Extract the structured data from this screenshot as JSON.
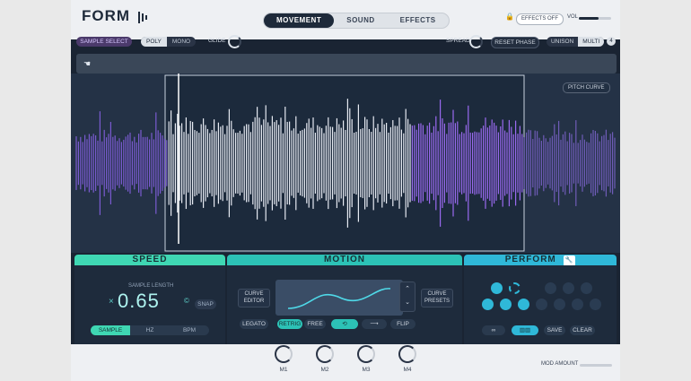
{
  "header": {
    "logo": "FORM",
    "tabs": [
      {
        "label": "MOVEMENT",
        "active": true
      },
      {
        "label": "SOUND",
        "active": false
      },
      {
        "label": "EFFECTS",
        "active": false
      }
    ],
    "effects_off": "EFFECTS OFF",
    "vol_label": "VOL",
    "vol_level": 0.6
  },
  "controls": {
    "sample_select": "SAMPLE SELECT",
    "poly": "POLY",
    "mono": "MONO",
    "glide": "GLIDE",
    "spread": "SPREAD",
    "reset_phase": "RESET PHASE",
    "unison": "UNISON",
    "multi": "MULTI",
    "unison_count": "4"
  },
  "waveform": {
    "pitch_curve": "PITCH CURVE"
  },
  "speed": {
    "title": "SPEED",
    "sample_length_label": "SAMPLE LENGTH",
    "value": "0.65",
    "x_mark": "×",
    "c_mark": "©",
    "snap": "SNAP",
    "modes": [
      {
        "label": "SAMPLE",
        "active": true
      },
      {
        "label": "HZ",
        "active": false
      },
      {
        "label": "BPM",
        "active": false
      }
    ]
  },
  "motion": {
    "title": "MOTION",
    "curve_editor_1": "CURVE",
    "curve_editor_2": "EDITOR",
    "curve_presets_1": "CURVE",
    "curve_presets_2": "PRESETS",
    "legato": "LEGATO",
    "retrig": "RETRIG",
    "free": "FREE",
    "flip": "FLIP"
  },
  "perform": {
    "title": "PERFORM",
    "save": "SAVE",
    "clear": "CLEAR",
    "link": "∞"
  },
  "footer": {
    "macros": [
      "M1",
      "M2",
      "M3",
      "M4"
    ],
    "mod_amount": "MOD AMOUNT"
  },
  "colors": {
    "speed": "#3fd7b3",
    "motion": "#2cc2b6",
    "perform": "#2fb8d8",
    "wave_purple": "#8a63e0",
    "wave_white": "#e6eaf2"
  }
}
